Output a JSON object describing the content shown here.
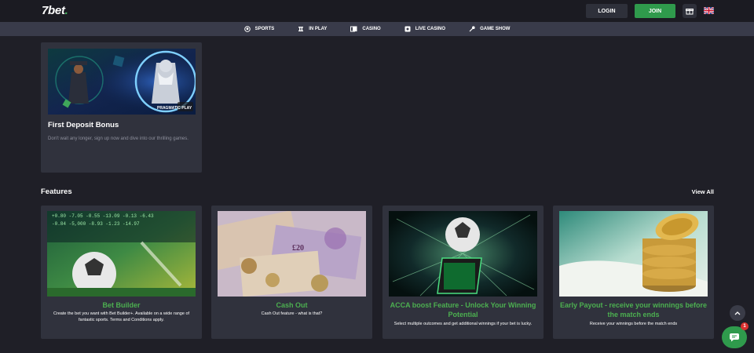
{
  "header": {
    "logo_main": "7bet",
    "logo_dot": ".",
    "login_label": "LOGIN",
    "join_label": "JOIN",
    "gift_icon": "gift-icon",
    "flag_icon": "uk-flag-icon"
  },
  "nav": {
    "items": [
      {
        "label": "SPORTS",
        "icon": "football-icon"
      },
      {
        "label": "IN PLAY",
        "icon": "in-play-icon"
      },
      {
        "label": "CASINO",
        "icon": "casino-cards-icon"
      },
      {
        "label": "LIVE CASINO",
        "icon": "live-casino-icon"
      },
      {
        "label": "GAME SHOW",
        "icon": "microphone-icon"
      }
    ]
  },
  "promo": {
    "title": "First Deposit Bonus",
    "description": "Don't wait any longer, sign up now and dive into our thrilling games.",
    "badge": "PRAGMATIC PLAY"
  },
  "features": {
    "section_title": "Features",
    "view_all": "View All",
    "cards": [
      {
        "title": "Bet Builder",
        "description": "Create the bet you want with Bet Builder+. Available on a wide range of fantastic sports. Terms and Conditions apply."
      },
      {
        "title": "Cash Out",
        "description": "Cash Out feature - what is that?"
      },
      {
        "title": "ACCA boost Feature - Unlock Your Winning Potential",
        "description": "Select multiple outcomes and get additional winnings if your bet is lucky."
      },
      {
        "title": "Early Payout - receive your winnings before the match ends",
        "description": "Receive your winnings before the match ends"
      }
    ]
  },
  "widgets": {
    "chat_badge": "1"
  },
  "colors": {
    "accent_green": "#2f9a4c",
    "feature_title_green": "#4caf50",
    "background": "#1f1f27",
    "card": "#30323d"
  }
}
